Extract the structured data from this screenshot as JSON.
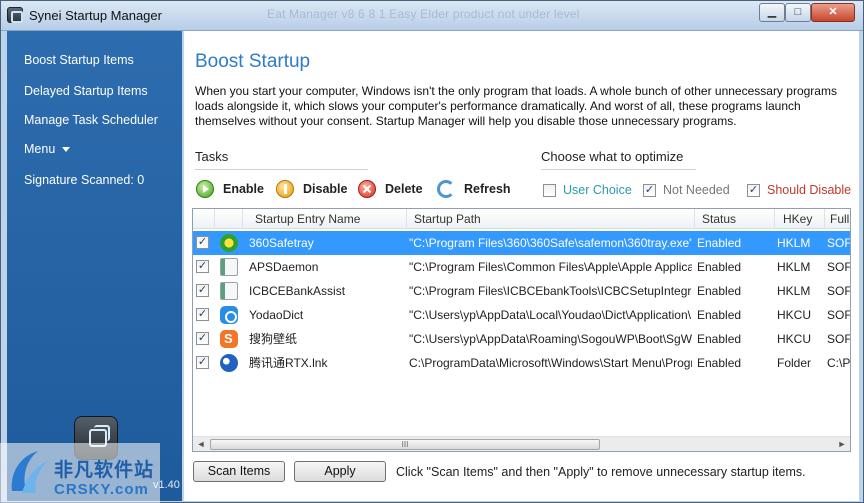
{
  "window": {
    "title": "Synei Startup Manager",
    "faded_title": "Eat Manager v8 6 8 1   Easy Elder product not under level",
    "minimize_glyph": "▁",
    "maximize_glyph": "□",
    "close_glyph": "✕"
  },
  "sidebar": {
    "items": [
      {
        "label": "Boost Startup Items"
      },
      {
        "label": "Delayed Startup Items"
      },
      {
        "label": "Manage Task Scheduler"
      },
      {
        "label": "Menu"
      },
      {
        "label": "Signature Scanned: 0"
      }
    ],
    "version": "v1.40"
  },
  "main": {
    "heading": "Boost Startup",
    "description": "When you start your computer, Windows isn't the only program that loads. A whole bunch of other unnecessary programs loads alongside it, which slows your computer's performance dramatically. And worst of all, these programs launch themselves without your consent. Startup Manager will help you disable those unnecessary programs.",
    "tasks_title": "Tasks",
    "tasks": {
      "enable": "Enable",
      "disable": "Disable",
      "delete": "Delete",
      "refresh": "Refresh"
    },
    "optimize_title": "Choose what to optimize",
    "optimize": [
      {
        "label": "User Choice",
        "checked": false,
        "color": "#2a9aa8"
      },
      {
        "label": "Not Needed",
        "checked": true,
        "color": "#777777"
      },
      {
        "label": "Should Disable",
        "checked": true,
        "color": "#c0392b"
      }
    ],
    "table": {
      "columns": [
        "Startup Entry Name",
        "Startup Path",
        "Status",
        "HKey",
        "Full"
      ],
      "rows": [
        {
          "name": "360Safetray",
          "path": "\"C:\\Program Files\\360\\360Safe\\safemon\\360tray.exe\" /...",
          "status": "Enabled",
          "hkey": "HKLM",
          "full": "SOF",
          "icon": "360-icon",
          "selected": true
        },
        {
          "name": "APSDaemon",
          "path": "\"C:\\Program Files\\Common Files\\Apple\\Apple Application...",
          "status": "Enabled",
          "hkey": "HKLM",
          "full": "SOF",
          "icon": "app-icon",
          "selected": false
        },
        {
          "name": "ICBCEBankAssist",
          "path": "\"C:\\Program Files\\ICBCEbankTools\\ICBCSetupIntegratio...",
          "status": "Enabled",
          "hkey": "HKLM",
          "full": "SOF",
          "icon": "app-icon",
          "selected": false
        },
        {
          "name": "YodaoDict",
          "path": "\"C:\\Users\\yp\\AppData\\Local\\Youdao\\Dict\\Application\\...",
          "status": "Enabled",
          "hkey": "HKCU",
          "full": "SOF",
          "icon": "youdao-icon",
          "selected": false
        },
        {
          "name": "搜狗壁纸",
          "path": "\"C:\\Users\\yp\\AppData\\Roaming\\SogouWP\\Boot\\SgW...",
          "status": "Enabled",
          "hkey": "HKCU",
          "full": "SOF",
          "icon": "sogou-icon",
          "selected": false
        },
        {
          "name": "腾讯通RTX.lnk",
          "path": "C:\\ProgramData\\Microsoft\\Windows\\Start Menu\\Progra...",
          "status": "Enabled",
          "hkey": "Folder",
          "full": "C:\\P",
          "icon": "rtx-icon",
          "selected": false
        }
      ]
    },
    "scrollbar": {
      "left_arrow": "◄",
      "right_arrow": "►",
      "grip": "III"
    },
    "buttons": {
      "scan": "Scan Items",
      "apply": "Apply"
    },
    "hint": "Click \"Scan Items\" and then \"Apply\" to remove unnecessary startup items."
  },
  "watermark": {
    "cn": "非凡软件站",
    "en": "CRSKY.com"
  }
}
